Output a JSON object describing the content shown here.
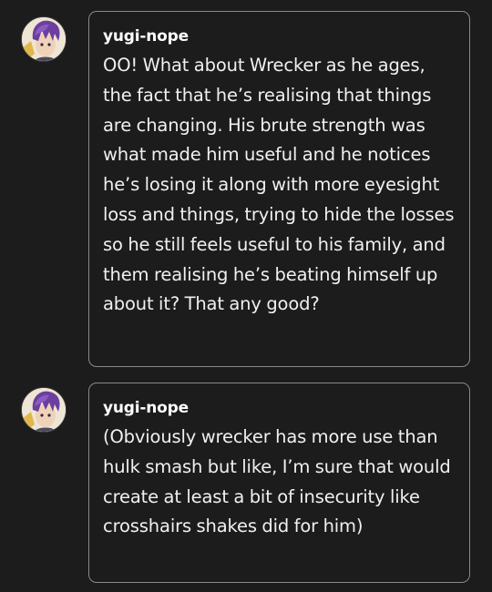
{
  "messages": [
    {
      "username": "yugi-nope",
      "text": "OO! What about Wrecker as he ages, the fact that he’s realising that things are changing. His brute strength was what made him useful and he notices he’s losing it along with more eyesight loss and things, trying to hide the losses so he still feels useful to his family, and them realising he’s beating himself up about it? That any good?"
    },
    {
      "username": "yugi-nope",
      "text": "(Obviously wrecker has more use than hulk smash but like, I’m sure that would create at least a bit of insecurity like crosshairs shakes did for him)"
    }
  ],
  "colors": {
    "background": "#1c1c1c",
    "bubble_border": "#8a8a8a",
    "text": "#f0f0f0",
    "avatar_hair": "#6b3fa0"
  },
  "icons": {
    "avatar": "user-avatar-purple-hair"
  }
}
